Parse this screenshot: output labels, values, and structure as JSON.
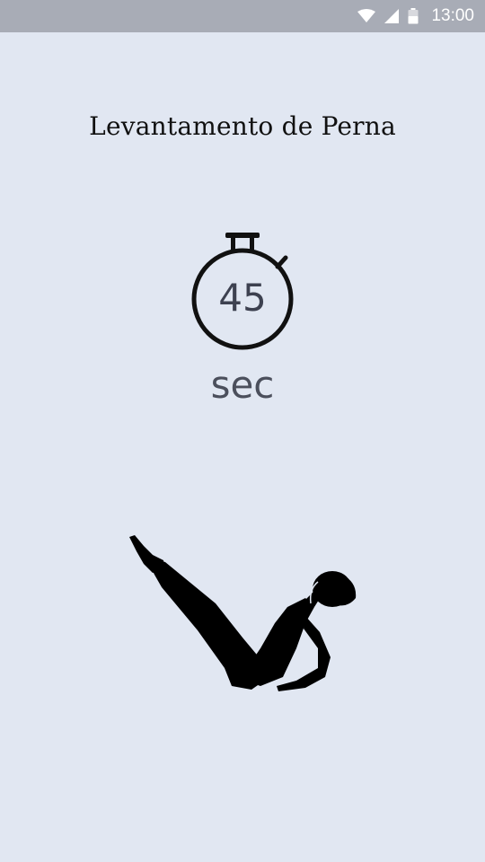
{
  "status_bar": {
    "time": "13:00",
    "icons": [
      "wifi-icon",
      "cell-signal-icon",
      "battery-icon"
    ]
  },
  "exercise": {
    "title": "Levantamento de Perna",
    "duration_value": "45",
    "duration_unit": "sec",
    "illustration": "v-sit-leg-raise-figure-icon"
  },
  "colors": {
    "background": "#e1e7f2",
    "status_bar": "#a8acb6",
    "text_dark": "#111111",
    "timer_text": "#3d4150"
  }
}
